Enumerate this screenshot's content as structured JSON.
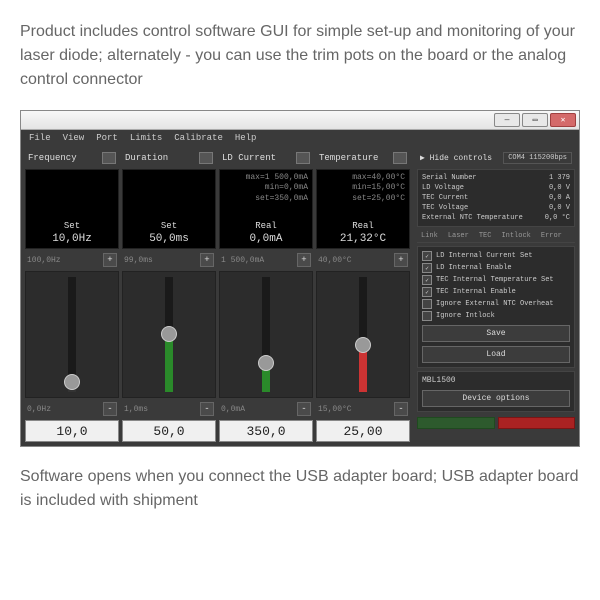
{
  "intro": "Product includes control software GUI for simple set-up and monitoring of your laser diode; alternately - you can use the trim pots on the board or the analog control connector",
  "outro": "Software opens when you connect the USB adapter board; USB adapter board is included with shipment",
  "menubar": [
    "File",
    "View",
    "Port",
    "Limits",
    "Calibrate",
    "Help"
  ],
  "channels": [
    {
      "title": "Frequency",
      "minmax": [],
      "setlabel": "Set",
      "setvalue": "10,0Hz",
      "max_label": "100,0Hz",
      "min_label": "0,0Hz",
      "input": "10,0",
      "fill_color": "#333",
      "fill_pct": 8
    },
    {
      "title": "Duration",
      "minmax": [],
      "setlabel": "Set",
      "setvalue": "50,0ms",
      "max_label": "99,0ms",
      "min_label": "1,0ms",
      "input": "50,0",
      "fill_color": "#2a8a2a",
      "fill_pct": 50
    },
    {
      "title": "LD Current",
      "minmax": [
        "max=1 500,0mA",
        "min=0,0mA",
        "set=350,0mA"
      ],
      "setlabel": "Real",
      "setvalue": "0,0mA",
      "max_label": "1 500,0mA",
      "min_label": "0,0mA",
      "input": "350,0",
      "fill_color": "#2a8a2a",
      "fill_pct": 24
    },
    {
      "title": "Temperature",
      "minmax": [
        "max=40,00°C",
        "min=15,00°C",
        "set=25,00°C"
      ],
      "setlabel": "Real",
      "setvalue": "21,32°C",
      "max_label": "40,00°C",
      "min_label": "15,00°C",
      "input": "25,00",
      "fill_color": "#cc3333",
      "fill_pct": 40
    }
  ],
  "right": {
    "hide": "▶ Hide controls",
    "com": "COM4   115200bps",
    "info": [
      {
        "k": "Serial Number",
        "v": "1 379"
      },
      {
        "k": "LD Voltage",
        "v": "0,0  V"
      },
      {
        "k": "TEC Current",
        "v": "0,0  A"
      },
      {
        "k": "TEC Voltage",
        "v": "0,0  V"
      },
      {
        "k": "External NTC Temperature",
        "v": "0,0 °C"
      }
    ],
    "tabs": [
      "Link",
      "Laser",
      "TEC",
      "Intlock",
      "Error"
    ],
    "checks": [
      {
        "checked": true,
        "label": "LD Internal Current Set"
      },
      {
        "checked": true,
        "label": "LD Internal Enable"
      },
      {
        "checked": true,
        "label": "TEC Internal Temperature Set"
      },
      {
        "checked": true,
        "label": "TEC Internal Enable"
      },
      {
        "checked": false,
        "label": "Ignore External NTC Overheat"
      },
      {
        "checked": false,
        "label": "Ignore Intlock"
      }
    ],
    "save": "Save",
    "load": "Load",
    "device_model": "MBL1500",
    "device_options": "Device options",
    "start": "",
    "stop": ""
  }
}
